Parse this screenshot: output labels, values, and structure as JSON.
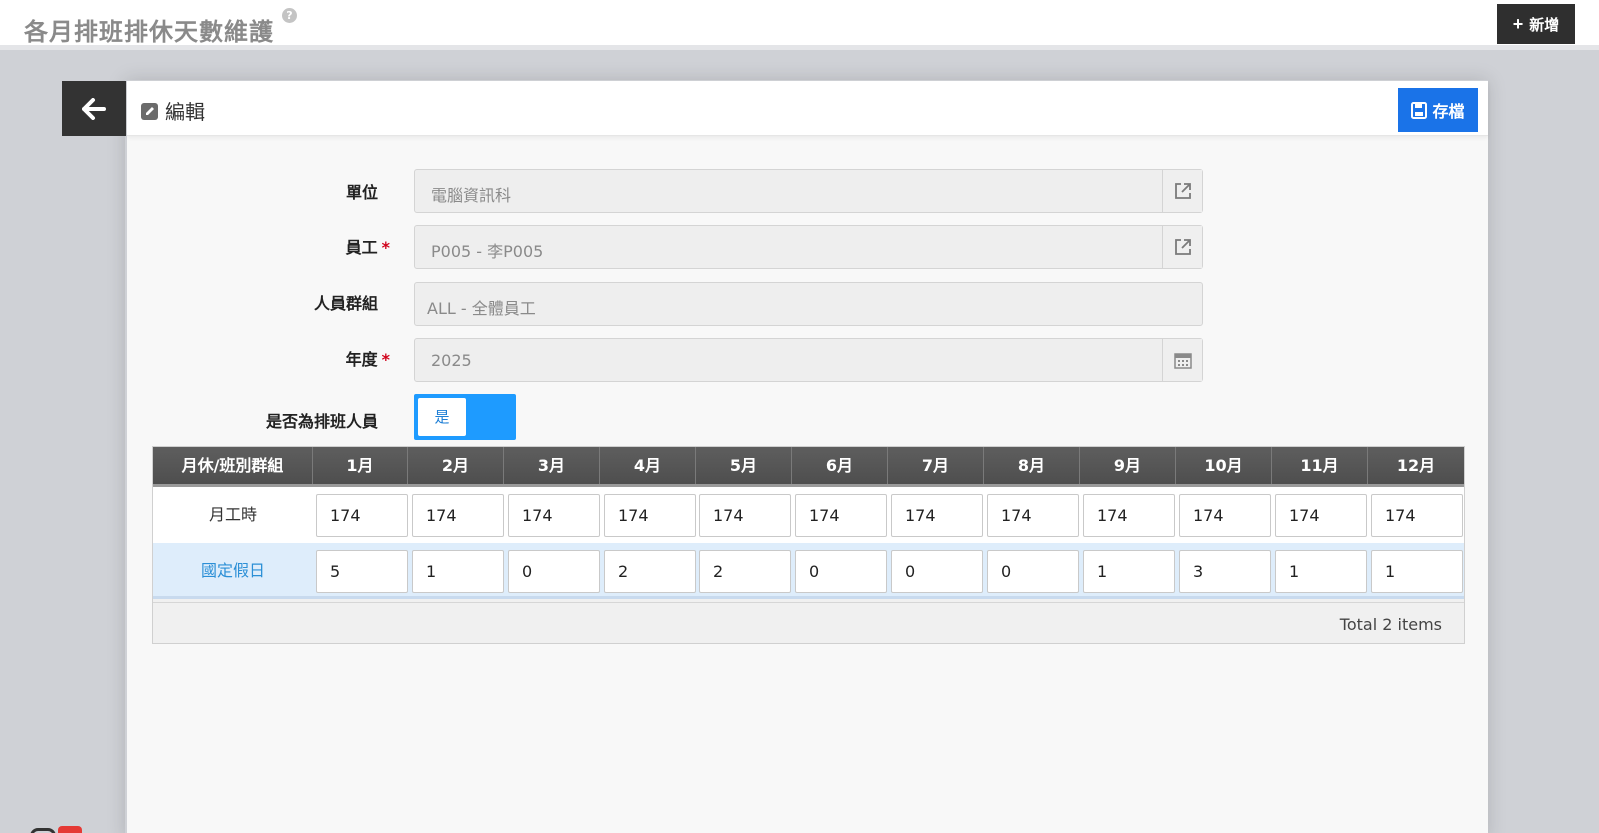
{
  "header": {
    "title": "各月排班排休天數維護",
    "help_icon": "question-circle-icon",
    "add_label": "新增",
    "add_icon": "plus-icon"
  },
  "panel": {
    "back_icon": "arrow-left-icon",
    "title": "編輯",
    "edit_icon": "edit-icon",
    "save_label": "存檔",
    "save_icon": "floppy-disk-icon",
    "accent_color": "#1a73e8"
  },
  "form": {
    "unit": {
      "label": "單位",
      "value": "電腦資訊科",
      "addon_icon": "external-link-icon"
    },
    "employee": {
      "label": "員工",
      "required_mark": "*",
      "value": "P005 - 李P005",
      "addon_icon": "external-link-icon"
    },
    "group": {
      "label": "人員群組",
      "value": "ALL - 全體員工"
    },
    "year": {
      "label": "年度",
      "required_mark": "*",
      "value": "2025",
      "addon_icon": "calendar-icon"
    },
    "is_scheduler": {
      "label": "是否為排班人員",
      "toggle_text": "是",
      "on": true,
      "toggle_color": "#1e9bff"
    }
  },
  "grid": {
    "columns": [
      "月休/班別群組",
      "1月",
      "2月",
      "3月",
      "4月",
      "5月",
      "6月",
      "7月",
      "8月",
      "9月",
      "10月",
      "11月",
      "12月"
    ],
    "rows": [
      {
        "label": "月工時",
        "values": [
          "174",
          "174",
          "174",
          "174",
          "174",
          "174",
          "174",
          "174",
          "174",
          "174",
          "174",
          "174"
        ]
      },
      {
        "label": "國定假日",
        "values": [
          "5",
          "1",
          "0",
          "2",
          "2",
          "0",
          "0",
          "0",
          "1",
          "3",
          "1",
          "1"
        ]
      }
    ],
    "footer": "Total 2 items"
  }
}
